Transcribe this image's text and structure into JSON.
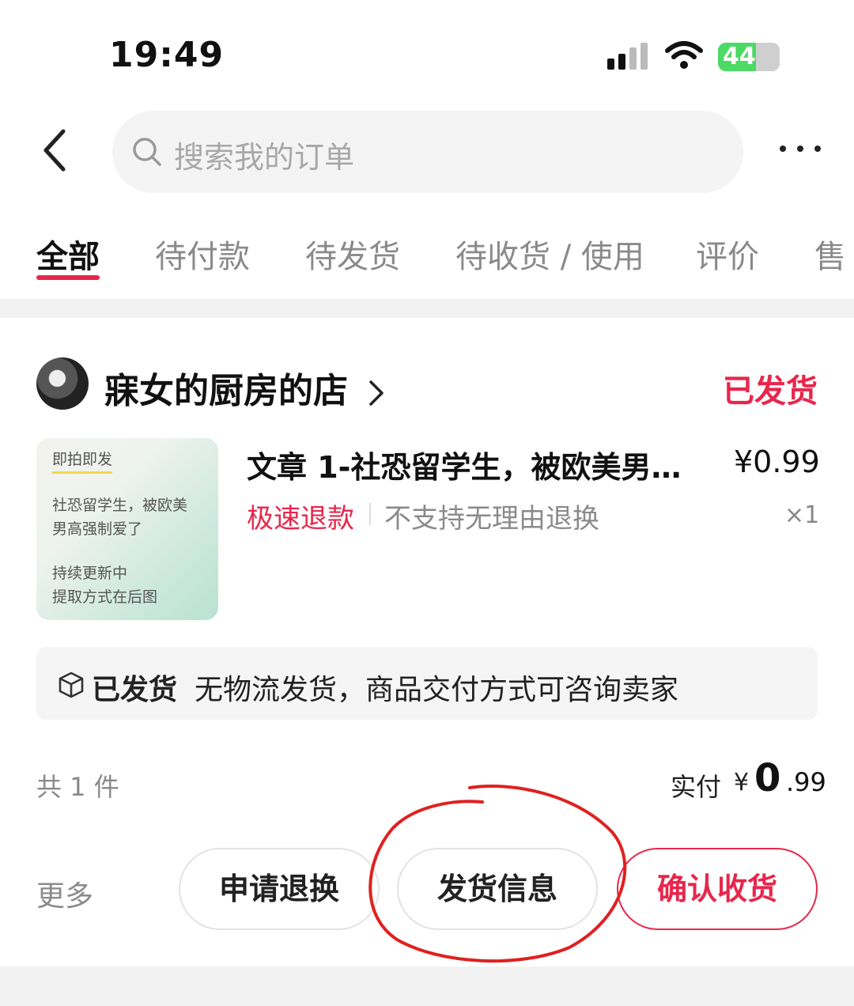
{
  "status_bar": {
    "time": "19:49",
    "battery": "44"
  },
  "search": {
    "placeholder": "搜索我的订单"
  },
  "tabs": [
    {
      "label": "全部"
    },
    {
      "label": "待付款"
    },
    {
      "label": "待发货"
    },
    {
      "label": "待收货 / 使用"
    },
    {
      "label": "评价"
    },
    {
      "label": "售"
    }
  ],
  "order": {
    "shop_name": "寐女的厨房的店",
    "status": "已发货",
    "product": {
      "thumb_lines": [
        "即拍即发",
        "社恐留学生，被欧美",
        "男高强制爱了",
        "持续更新中",
        "提取方式在后图"
      ],
      "title": "文章 1-社恐留学生，被欧美男…",
      "price": "¥0.99",
      "tag_fast_refund": "极速退款",
      "tag_no_return": "不支持无理由退换",
      "quantity": "×1"
    },
    "shipping": {
      "status": "已发货",
      "text": "无物流发货，商品交付方式可咨询卖家"
    },
    "count_text": "共 1 件",
    "paid_label": "实付",
    "paid_currency": "¥",
    "paid_int": "0",
    "paid_dec": ".99"
  },
  "actions": {
    "more": "更多",
    "refund": "申请退换",
    "shipping_info": "发货信息",
    "confirm": "确认收货"
  },
  "colors": {
    "accent": "#e8264b",
    "annotation": "#e02020"
  }
}
